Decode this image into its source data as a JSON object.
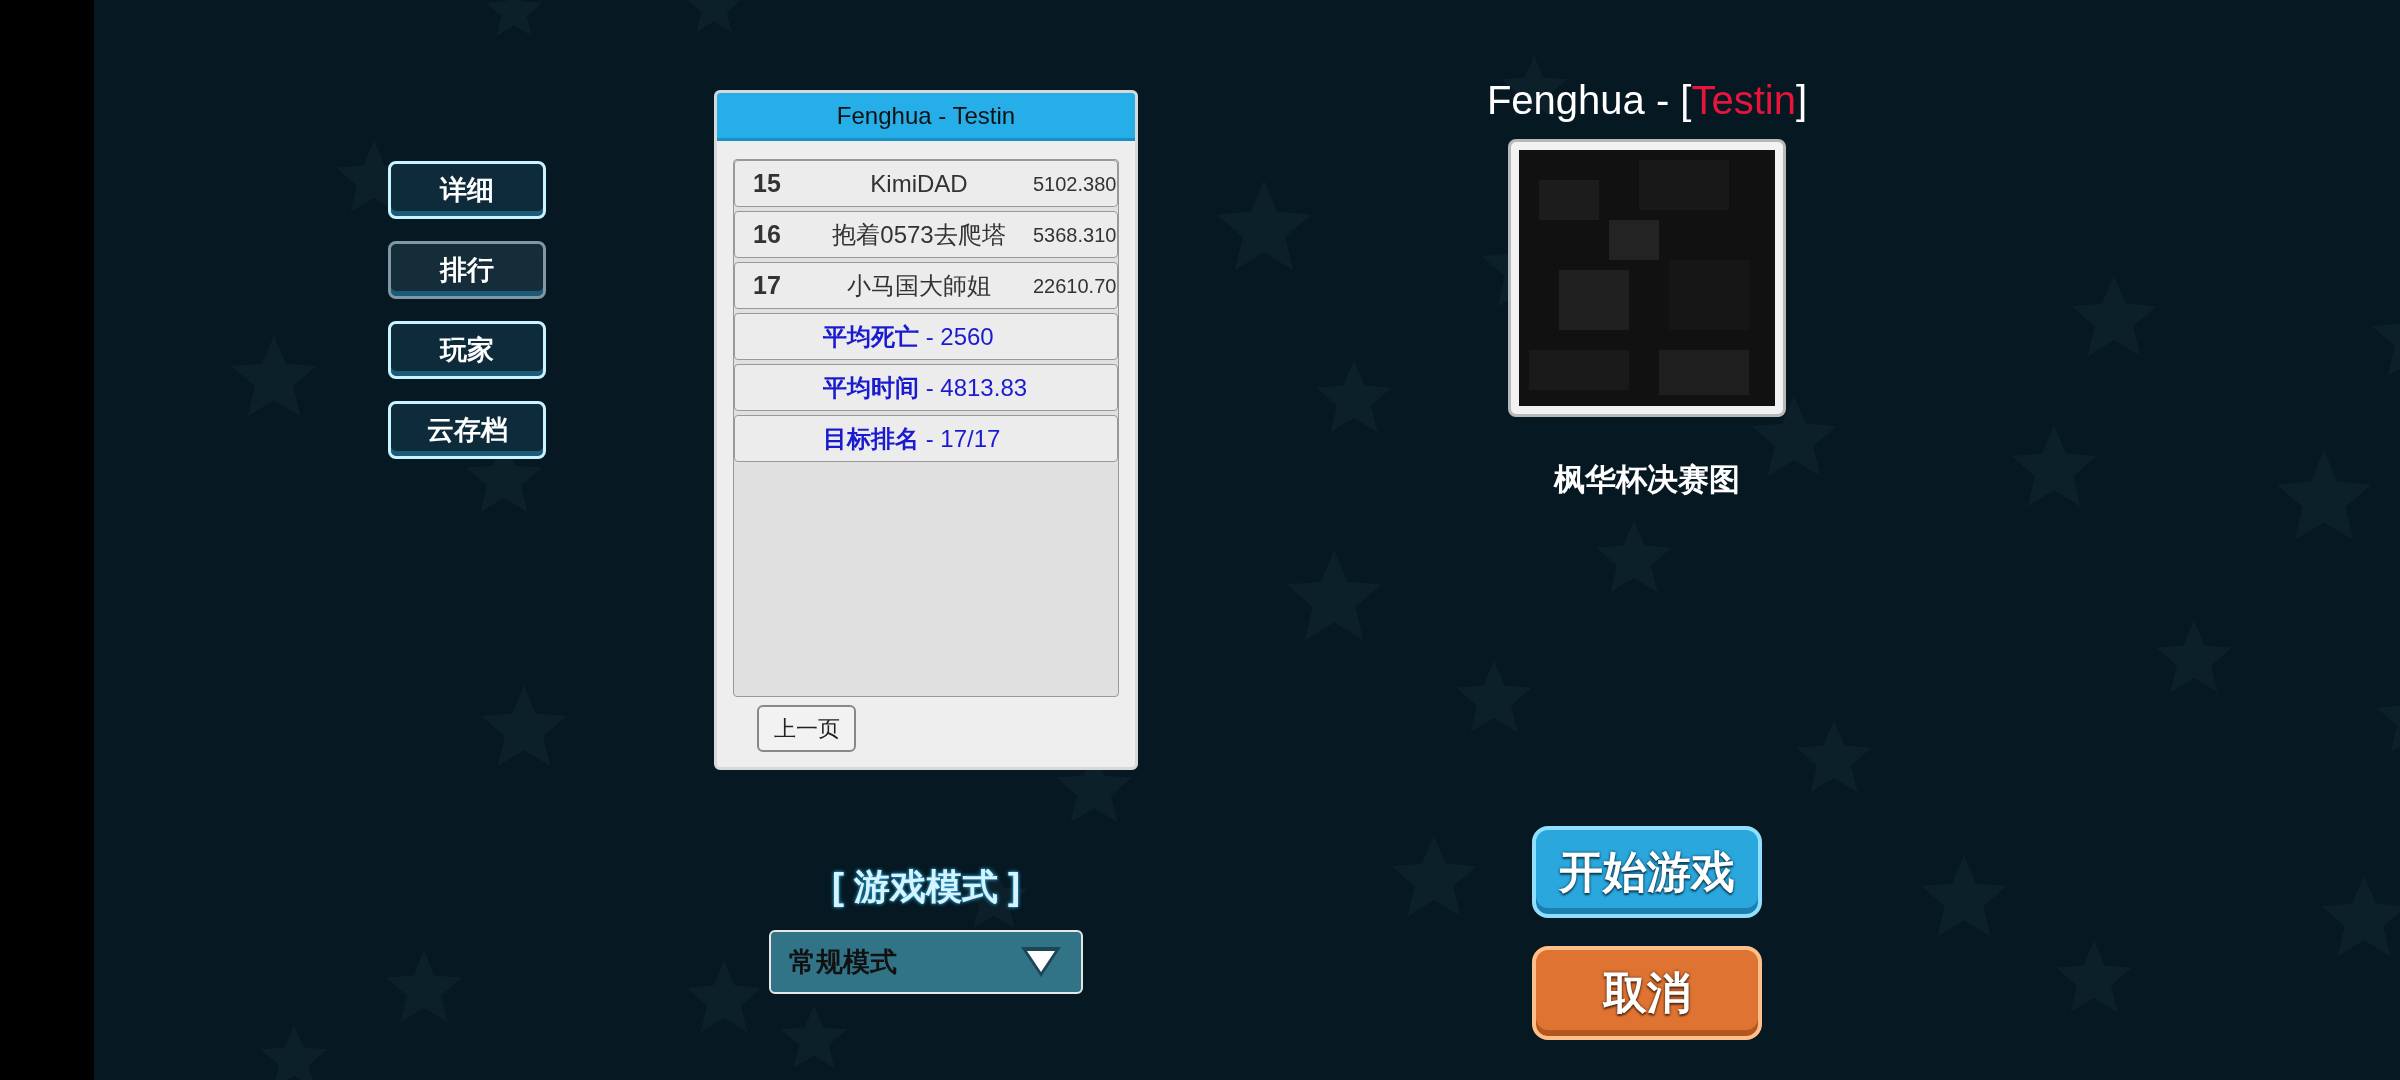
{
  "side_menu": [
    {
      "label": "详细",
      "selected": false
    },
    {
      "label": "排行",
      "selected": true
    },
    {
      "label": "玩家",
      "selected": false
    },
    {
      "label": "云存档",
      "selected": false
    }
  ],
  "leaderboard": {
    "title": "Fenghua - Testin",
    "rows": [
      {
        "rank": "15",
        "name": "KimiDAD",
        "score": "5102.380"
      },
      {
        "rank": "16",
        "name": "抱着0573去爬塔",
        "score": "5368.310"
      },
      {
        "rank": "17",
        "name": "小马国大師姐",
        "score": "22610.70"
      }
    ],
    "stats": [
      "**平均死亡** - 2560",
      "**平均时间** - 4813.83",
      "**目标排名** - 17/17"
    ],
    "prev_button": "上一页"
  },
  "map": {
    "title_before": "Fenghua - [",
    "title_highlight": "Testin",
    "title_after": "]",
    "caption": "枫华杯决赛图"
  },
  "game_mode": {
    "label": "[ 游戏模式 ]",
    "value": "常规模式"
  },
  "buttons": {
    "start": "开始游戏",
    "cancel": "取消"
  }
}
